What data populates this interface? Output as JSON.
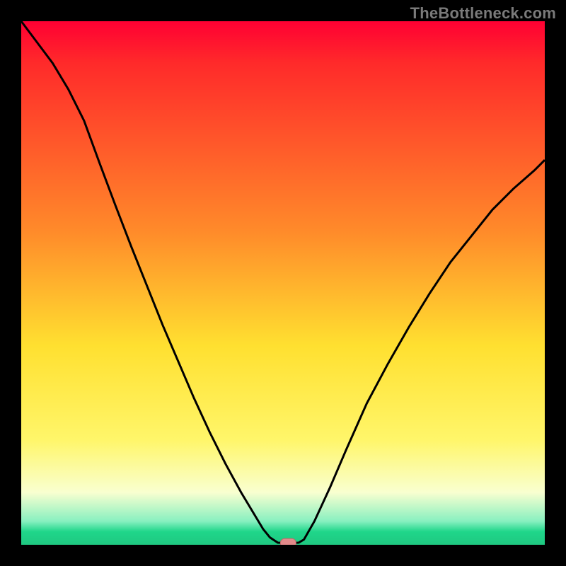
{
  "watermark": "TheBottleneck.com",
  "colors": {
    "black": "#000000",
    "curve": "#000000",
    "marker_fill": "#e28a8a",
    "marker_stroke": "#c06a6a",
    "grad_top": "#ff0033",
    "grad_red": "#ff2a2a",
    "grad_orange": "#ff8a2a",
    "grad_yellow": "#ffe030",
    "grad_ltyellow": "#fff66a",
    "grad_cream": "#f9ffd0",
    "grad_mint": "#88f0c0",
    "grad_green": "#1fd68a",
    "grad_green2": "#1fc881"
  },
  "chart_data": {
    "type": "line",
    "title": "",
    "xlabel": "",
    "ylabel": "",
    "xlim": [
      0,
      1
    ],
    "ylim": [
      0,
      1
    ],
    "series": [
      {
        "name": "bottleneck-curve",
        "x": [
          0.0,
          0.03,
          0.06,
          0.09,
          0.12,
          0.15,
          0.18,
          0.21,
          0.24,
          0.27,
          0.3,
          0.33,
          0.36,
          0.39,
          0.42,
          0.45,
          0.462,
          0.475,
          0.49,
          0.51,
          0.53,
          0.54,
          0.56,
          0.59,
          0.62,
          0.66,
          0.7,
          0.74,
          0.78,
          0.82,
          0.86,
          0.9,
          0.94,
          0.98,
          1.0
        ],
        "y": [
          1.0,
          0.96,
          0.92,
          0.87,
          0.81,
          0.728,
          0.648,
          0.57,
          0.495,
          0.42,
          0.35,
          0.28,
          0.215,
          0.155,
          0.1,
          0.05,
          0.03,
          0.014,
          0.004,
          0.003,
          0.004,
          0.01,
          0.045,
          0.11,
          0.18,
          0.27,
          0.345,
          0.415,
          0.48,
          0.54,
          0.59,
          0.64,
          0.68,
          0.715,
          0.735
        ]
      }
    ],
    "marker": {
      "x": 0.51,
      "y": 0.003
    },
    "gradient_stops": [
      {
        "offset": 0.0,
        "key": "grad_top"
      },
      {
        "offset": 0.08,
        "key": "grad_red"
      },
      {
        "offset": 0.4,
        "key": "grad_orange"
      },
      {
        "offset": 0.62,
        "key": "grad_yellow"
      },
      {
        "offset": 0.8,
        "key": "grad_ltyellow"
      },
      {
        "offset": 0.9,
        "key": "grad_cream"
      },
      {
        "offset": 0.955,
        "key": "grad_mint"
      },
      {
        "offset": 0.975,
        "key": "grad_green"
      },
      {
        "offset": 1.0,
        "key": "grad_green2"
      }
    ]
  }
}
